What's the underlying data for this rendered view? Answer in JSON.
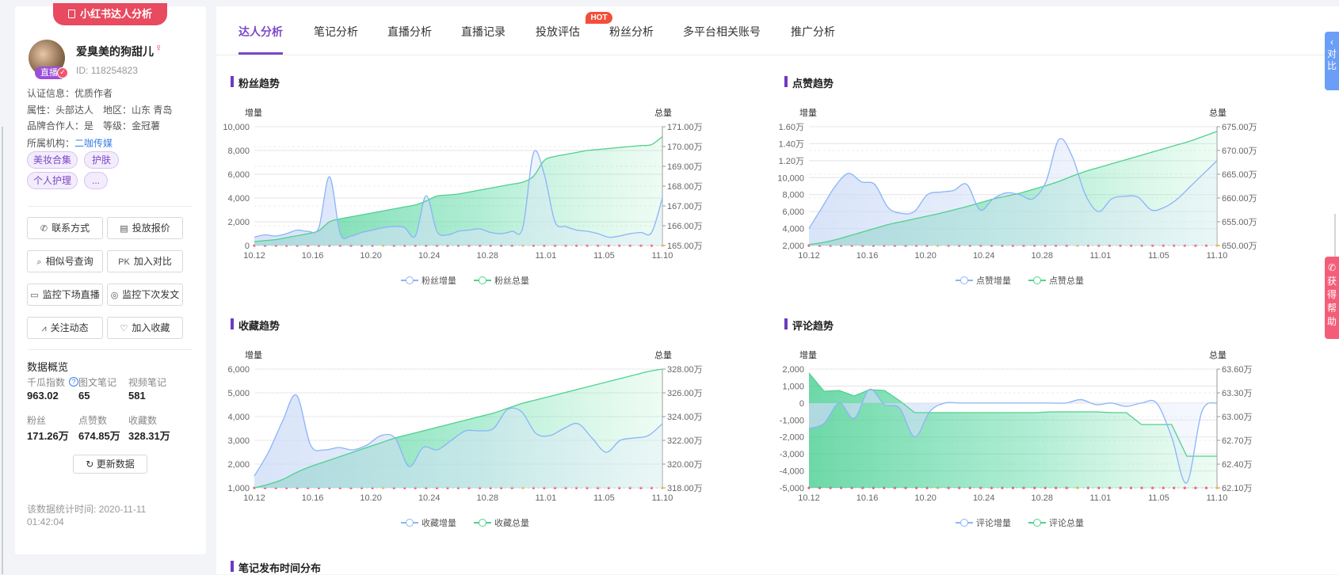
{
  "profile": {
    "pill_label": "小红书达人分析",
    "nickname": "爱臭美的狗甜儿",
    "id_label": "ID:",
    "id_value": "118254823",
    "live_badge": "直播",
    "cert": "认证信息：优质作者",
    "attr": "属性：头部达人",
    "region": "地区：山东 青岛",
    "brand": "品牌合作人：是",
    "level": "等级：金冠薯",
    "org_label": "所属机构：",
    "org_value": "二咖传媒",
    "tags": [
      "美妆合集",
      "护肤",
      "个人护理",
      "..."
    ],
    "buttons": [
      {
        "label": "联系方式",
        "icon": "phone-icon",
        "glyph": "✆"
      },
      {
        "label": "投放报价",
        "icon": "document-icon",
        "glyph": "▤"
      },
      {
        "label": "相似号查询",
        "icon": "search-icon",
        "glyph": "⌕"
      },
      {
        "label": "加入对比",
        "icon": "pk-icon",
        "glyph": "PK"
      },
      {
        "label": "监控下场直播",
        "icon": "video-icon",
        "glyph": "▭"
      },
      {
        "label": "监控下次发文",
        "icon": "location-icon",
        "glyph": "◎"
      },
      {
        "label": "关注动态",
        "icon": "trend-icon",
        "glyph": "⩘"
      },
      {
        "label": "加入收藏",
        "icon": "heart-icon",
        "glyph": "♡"
      }
    ],
    "overview": {
      "title": "数据概览",
      "items": [
        {
          "label": "千瓜指数",
          "value": "963.02"
        },
        {
          "label": "图文笔记",
          "value": "65"
        },
        {
          "label": "视频笔记",
          "value": "581"
        },
        {
          "label": "粉丝",
          "value": "171.26万"
        },
        {
          "label": "点赞数",
          "value": "674.85万"
        },
        {
          "label": "收藏数",
          "value": "328.31万"
        }
      ],
      "refresh_label": "更新数据",
      "stat_time": "该数据统计时间: 2020-11-11 01:42:04"
    }
  },
  "tabs": [
    "达人分析",
    "笔记分析",
    "直播分析",
    "直播记录",
    "投放评估",
    "粉丝分析",
    "多平台相关账号",
    "推广分析"
  ],
  "active_tab": "达人分析",
  "hot_badge": "HOT",
  "side_buttons": {
    "compare": "对比",
    "help": "获得帮助"
  },
  "sections": {
    "fans": "粉丝趋势",
    "likes": "点赞趋势",
    "collects": "收藏趋势",
    "comments": "评论趋势",
    "note_time": "笔记发布时间分布"
  },
  "colors": {
    "accent": "#7c48c7",
    "increment": "#8ab4f8",
    "total": "#4fd18c",
    "brand_red": "#e84a5f"
  },
  "chart_data": [
    {
      "type": "area",
      "title": "粉丝趋势",
      "ylabel": "增量",
      "y2label": "总量",
      "xticks": [
        "10.12",
        "10.16",
        "10.20",
        "10.24",
        "10.28",
        "11.01",
        "11.05",
        "11.10"
      ],
      "yticks": [
        "10,000",
        "8,000",
        "6,000",
        "4,000",
        "2,000",
        "0"
      ],
      "y2ticks": [
        "171.00万",
        "170.00万",
        "169.00万",
        "168.00万",
        "167.00万",
        "166.00万",
        "165.00万"
      ],
      "ylim": [
        0,
        10000
      ],
      "y2lim": [
        165.0,
        171.0
      ],
      "series": [
        {
          "name": "粉丝增量",
          "axis": "left",
          "values": [
            700,
            900,
            800,
            1000,
            1300,
            1200,
            1500,
            5800,
            1000,
            800,
            1100,
            1300,
            1500,
            1600,
            1500,
            800,
            4200,
            1200,
            900,
            1200,
            1300,
            1400,
            1100,
            1000,
            1200,
            1500,
            7800,
            6000,
            2000,
            1600,
            1300,
            1200,
            1000,
            700,
            800,
            1000,
            1100,
            1100,
            4000
          ]
        },
        {
          "name": "粉丝总量",
          "axis": "right",
          "values": [
            165.2,
            165.25,
            165.3,
            165.4,
            165.5,
            165.6,
            165.75,
            166.2,
            166.35,
            166.45,
            166.55,
            166.65,
            166.75,
            166.85,
            166.95,
            167.05,
            167.25,
            167.5,
            167.55,
            167.6,
            167.7,
            167.8,
            167.9,
            168.0,
            168.1,
            168.2,
            168.5,
            169.3,
            169.5,
            169.6,
            169.7,
            169.8,
            169.85,
            169.9,
            169.95,
            170.0,
            170.05,
            170.1,
            170.5
          ]
        }
      ]
    },
    {
      "type": "area",
      "title": "点赞趋势",
      "ylabel": "增量",
      "y2label": "总量",
      "xticks": [
        "10.12",
        "10.16",
        "10.20",
        "10.24",
        "10.28",
        "11.01",
        "11.05",
        "11.10"
      ],
      "yticks": [
        "1.60万",
        "1.40万",
        "1.20万",
        "10,000",
        "8,000",
        "6,000",
        "4,000",
        "2,000"
      ],
      "y2ticks": [
        "675.00万",
        "670.00万",
        "665.00万",
        "660.00万",
        "655.00万",
        "650.00万"
      ],
      "ylim": [
        2000,
        16000
      ],
      "y2lim": [
        650.0,
        675.0
      ],
      "series": [
        {
          "name": "点赞增量",
          "axis": "left",
          "values": [
            4000,
            6500,
            9000,
            10500,
            9500,
            9200,
            6500,
            5800,
            6000,
            8000,
            8300,
            8500,
            9200,
            6200,
            7500,
            8200,
            8000,
            7500,
            9500,
            14500,
            12500,
            8000,
            6000,
            7500,
            7800,
            7700,
            6200,
            6500,
            7500,
            9000,
            10500,
            12000
          ]
        },
        {
          "name": "点赞总量",
          "axis": "right",
          "values": [
            650.2,
            650.6,
            651.2,
            652.0,
            652.8,
            653.6,
            654.4,
            655.0,
            655.6,
            656.2,
            656.8,
            657.5,
            658.2,
            659.0,
            659.8,
            660.4,
            661.0,
            661.8,
            662.6,
            663.5,
            664.6,
            665.6,
            666.4,
            667.2,
            668.0,
            668.8,
            669.6,
            670.4,
            671.2,
            672.0,
            673.0,
            674.0
          ]
        }
      ]
    },
    {
      "type": "area",
      "title": "收藏趋势",
      "ylabel": "增量",
      "y2label": "总量",
      "xticks": [
        "10.12",
        "10.16",
        "10.20",
        "10.24",
        "10.28",
        "11.01",
        "11.05",
        "11.10"
      ],
      "yticks": [
        "6,000",
        "5,000",
        "4,000",
        "3,000",
        "2,000",
        "1,000"
      ],
      "y2ticks": [
        "328.00万",
        "326.00万",
        "324.00万",
        "322.00万",
        "320.00万",
        "318.00万"
      ],
      "ylim": [
        1000,
        6000
      ],
      "y2lim": [
        318.0,
        328.0
      ],
      "series": [
        {
          "name": "收藏增量",
          "axis": "left",
          "values": [
            1500,
            2500,
            3800,
            4900,
            2800,
            2600,
            2700,
            2600,
            2800,
            3200,
            3100,
            1900,
            2700,
            2600,
            3000,
            3400,
            3400,
            3500,
            4300,
            4200,
            3300,
            3200,
            3500,
            3700,
            3100,
            2500,
            3000,
            3100,
            3200,
            3700
          ]
        },
        {
          "name": "收藏总量",
          "axis": "right",
          "values": [
            318.0,
            318.3,
            318.7,
            319.3,
            319.8,
            320.2,
            320.6,
            321.0,
            321.4,
            321.8,
            322.2,
            322.5,
            322.8,
            323.1,
            323.4,
            323.7,
            324.0,
            324.3,
            324.7,
            325.1,
            325.4,
            325.7,
            326.0,
            326.3,
            326.6,
            326.9,
            327.2,
            327.5,
            327.8,
            328.0
          ]
        }
      ]
    },
    {
      "type": "area",
      "title": "评论趋势",
      "ylabel": "增量",
      "y2label": "总量",
      "xticks": [
        "10.12",
        "10.16",
        "10.20",
        "10.24",
        "10.28",
        "11.01",
        "11.05",
        "11.10"
      ],
      "yticks": [
        "2,000",
        "1,000",
        "0",
        "-1,000",
        "-2,000",
        "-3,000",
        "-4,000",
        "-5,000"
      ],
      "y2ticks": [
        "63.60万",
        "63.30万",
        "63.00万",
        "62.70万",
        "62.40万",
        "62.10万"
      ],
      "ylim": [
        -5000,
        2000
      ],
      "y2lim": [
        62.1,
        63.6
      ],
      "series": [
        {
          "name": "评论增量",
          "axis": "left",
          "values": [
            -1500,
            -1200,
            0,
            -900,
            800,
            -100,
            -300,
            -2000,
            -500,
            0,
            0,
            0,
            0,
            0,
            0,
            0,
            0,
            0,
            200,
            -100,
            0,
            -200,
            0,
            0,
            -2000,
            -4700,
            -500,
            0
          ]
        },
        {
          "name": "评论总量",
          "axis": "right",
          "values": [
            63.55,
            63.32,
            63.33,
            63.26,
            63.34,
            63.33,
            63.2,
            63.05,
            63.05,
            63.05,
            63.05,
            63.05,
            63.05,
            63.05,
            63.05,
            63.05,
            63.06,
            63.06,
            63.06,
            63.06,
            63.05,
            63.05,
            62.9,
            62.9,
            62.9,
            62.5,
            62.5,
            62.5
          ]
        }
      ]
    }
  ]
}
